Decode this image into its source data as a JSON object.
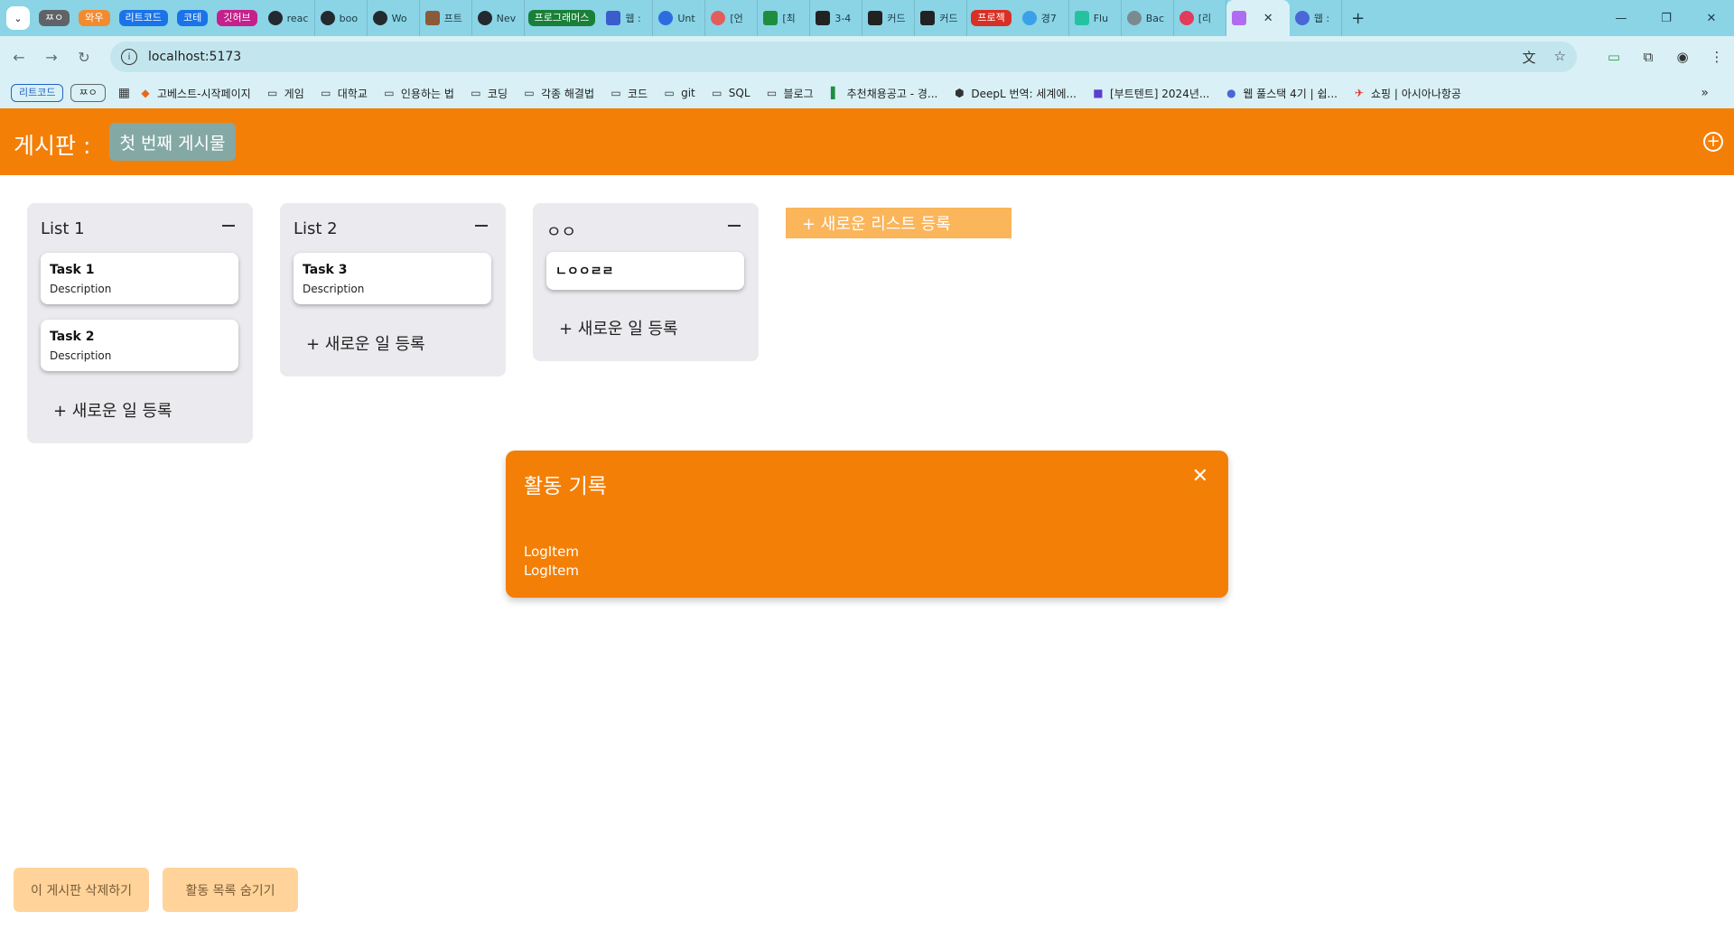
{
  "browser": {
    "tab_groups": [
      {
        "label": "ㅉㅇ",
        "color": "#5f6368"
      },
      {
        "label": "와우",
        "color": "#f28b30"
      },
      {
        "label": "리트코드",
        "color": "#1a73e8"
      },
      {
        "label": "코테",
        "color": "#1a73e8"
      },
      {
        "label": "깃허브",
        "color": "#c5208b"
      },
      {
        "label": "프로그래머스",
        "color": "#188038"
      },
      {
        "label": "프로젝",
        "color": "#d93025"
      }
    ],
    "tabs": [
      {
        "title": "reac",
        "icon": "github-icon"
      },
      {
        "title": "boo",
        "icon": "github-icon"
      },
      {
        "title": "Wo",
        "icon": "github-icon"
      },
      {
        "title": "프트",
        "icon": "image-icon"
      },
      {
        "title": "Nev",
        "icon": "github-icon"
      },
      {
        "title": "웹 :",
        "icon": "number-4-icon"
      },
      {
        "title": "Unt",
        "icon": "share-icon"
      },
      {
        "title": "[언",
        "icon": "red-circle-icon"
      },
      {
        "title": "[최",
        "icon": "green-plus-icon"
      },
      {
        "title": "3-4",
        "icon": "checkbox-icon"
      },
      {
        "title": "커드",
        "icon": "checkbox-icon"
      },
      {
        "title": "커드",
        "icon": "checkbox-icon"
      },
      {
        "title": "경7",
        "icon": "compass-icon"
      },
      {
        "title": "Flu",
        "icon": "v-icon"
      },
      {
        "title": "Bac",
        "icon": "globe-icon"
      },
      {
        "title": "[리",
        "icon": "heart-icon"
      },
      {
        "title": "",
        "icon": "vite-icon"
      },
      {
        "title": "웹 :",
        "icon": "gear-icon"
      }
    ],
    "url": "localhost:5173",
    "bookmark_pills": [
      "리트코드",
      "ㅉㅇ"
    ],
    "bookmarks": [
      {
        "label": "고베스트-시작페이지",
        "icon": "bookmark-site-icon"
      },
      {
        "label": "게임",
        "icon": "folder-icon"
      },
      {
        "label": "대학교",
        "icon": "folder-icon"
      },
      {
        "label": "인용하는 법",
        "icon": "folder-icon"
      },
      {
        "label": "코딩",
        "icon": "folder-icon"
      },
      {
        "label": "각종 해결법",
        "icon": "folder-icon"
      },
      {
        "label": "코드",
        "icon": "folder-icon"
      },
      {
        "label": "git",
        "icon": "folder-icon"
      },
      {
        "label": "SQL",
        "icon": "folder-icon"
      },
      {
        "label": "블로그",
        "icon": "folder-icon"
      },
      {
        "label": "추천채용공고 - 경...",
        "icon": "bookmark-site-icon"
      },
      {
        "label": "DeepL 번역: 세계에...",
        "icon": "deepl-icon"
      },
      {
        "label": "[부트텐트] 2024년...",
        "icon": "bookmark-site-icon"
      },
      {
        "label": "웹 풀스택 4기 | 쉽...",
        "icon": "bookmark-site-icon"
      },
      {
        "label": "쇼핑 | 아시아나항공",
        "icon": "bookmark-site-icon"
      }
    ]
  },
  "app": {
    "header": {
      "title": "게시판 :",
      "selected_board": "첫 번째 게시물",
      "add_board_icon": "plus-circle-icon"
    },
    "lists": [
      {
        "title": "List 1",
        "tasks": [
          {
            "title": "Task 1",
            "description": "Description"
          },
          {
            "title": "Task 2",
            "description": "Description"
          }
        ],
        "add_task_label": "+ 새로운 일 등록"
      },
      {
        "title": "List 2",
        "tasks": [
          {
            "title": "Task 3",
            "description": "Description"
          }
        ],
        "add_task_label": "+ 새로운 일 등록"
      },
      {
        "title": "ㅇㅇ",
        "tasks": [
          {
            "title": "ㄴㅇㅇㄹㄹ",
            "description": ""
          }
        ],
        "add_task_label": "+ 새로운 일 등록"
      }
    ],
    "add_list_label": "+ 새로운 리스트 등록",
    "activity_log": {
      "title": "활동 기록",
      "items": [
        "LogItem",
        "LogItem"
      ]
    },
    "footer": {
      "delete_board_label": "이 게시판 삭제하기",
      "hide_log_label": "활동 목록 숨기기"
    },
    "colors": {
      "accent": "#f47f06",
      "list_bg": "#ebebef",
      "add_list_bg": "#fbb55b",
      "button_bg": "#ffd39a",
      "selected_board_bg": "#84a9a5"
    }
  }
}
